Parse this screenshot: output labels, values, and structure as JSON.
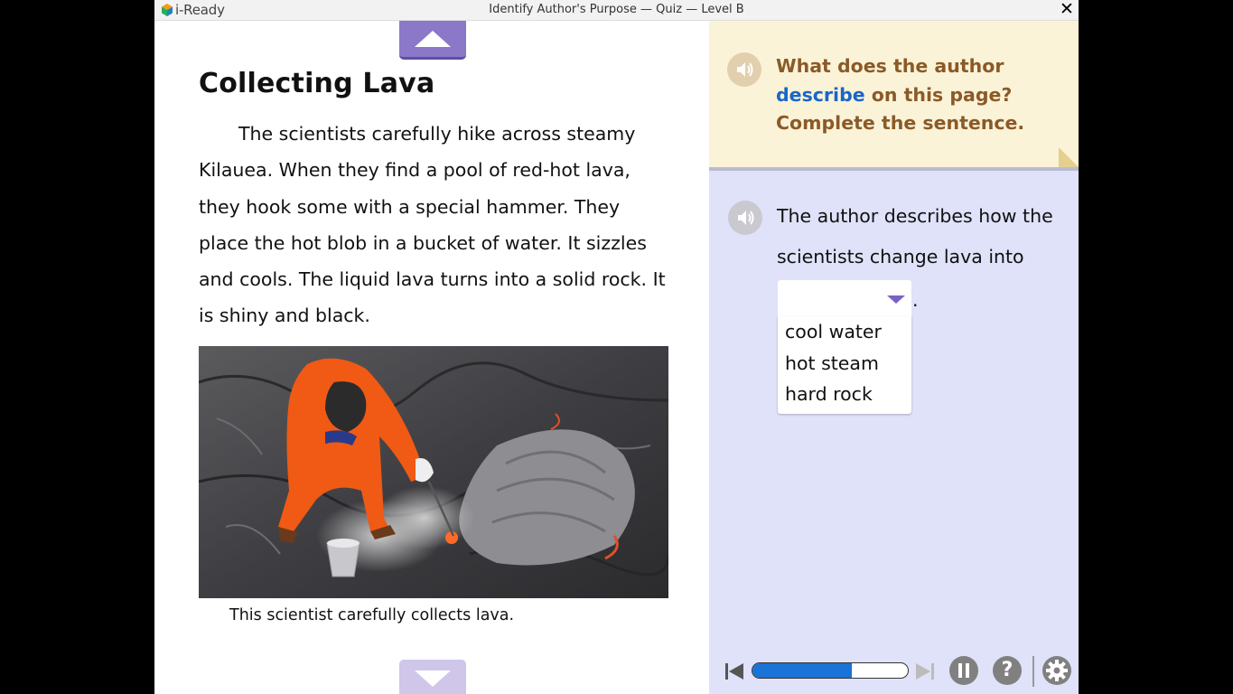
{
  "window": {
    "app_name": "i-Ready",
    "title": "Identify Author's Purpose — Quiz — Level B",
    "close_glyph": "✕"
  },
  "passage": {
    "title": "Collecting Lava",
    "body": "The scientists carefully hike across steamy Kilauea. When they find a pool of red-hot lava, they hook some with a special hammer. They place the hot blob in a bucket of water. It sizzles and cools. The liquid lava turns into a solid rock. It is shiny and black.",
    "photo_icon": "lava-photo",
    "caption": "This scientist carefully collects lava."
  },
  "question": {
    "prefix": "What does the author ",
    "keyword": "describe",
    "suffix": " on this page? Complete the sentence."
  },
  "answer": {
    "sentence": "The author describes how the scientists change lava into",
    "selected_value": "",
    "period": ".",
    "options": [
      "cool water",
      "hot steam",
      "hard rock"
    ]
  },
  "footer": {
    "progress_fraction": 0.64,
    "help_glyph": "?"
  },
  "colors": {
    "accent_purple": "#8b78c9",
    "question_brown": "#8a5a28",
    "keyword_blue": "#1a66c9",
    "progress_blue": "#1a73d6",
    "right_panel_bg": "#dfe2f8",
    "question_bg": "#fbf3d8"
  }
}
